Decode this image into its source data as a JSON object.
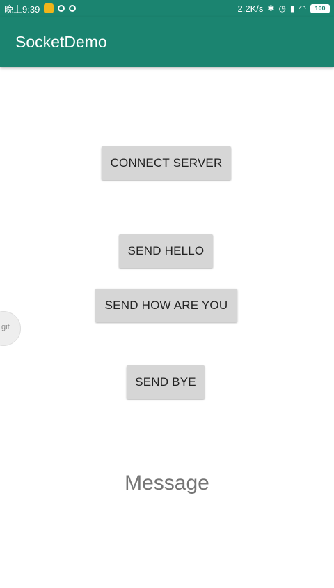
{
  "status_bar": {
    "time": "晚上9:39",
    "network_speed": "2.2K/s",
    "battery": "100",
    "icons": [
      "app-notification-icon",
      "record-icon",
      "record-icon",
      "bluetooth-icon",
      "alarm-icon",
      "signal-icon",
      "wifi-icon",
      "battery-icon"
    ]
  },
  "app_bar": {
    "title": "SocketDemo"
  },
  "buttons": {
    "connect": "CONNECT SERVER",
    "hello": "SEND HELLO",
    "how": "SEND HOW ARE YOU",
    "bye": "SEND BYE"
  },
  "message": {
    "text": "Message"
  },
  "floating": {
    "label": "gif"
  },
  "colors": {
    "primary": "#1b8470",
    "button_bg": "#d6d6d6",
    "message_text": "#757575"
  }
}
